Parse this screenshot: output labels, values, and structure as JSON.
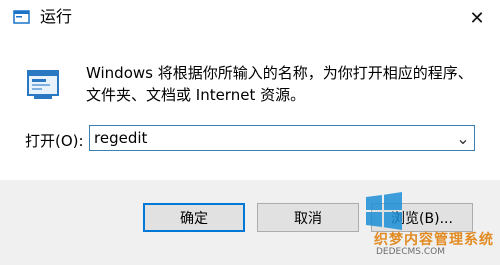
{
  "window": {
    "title": "运行",
    "close_glyph": "✕"
  },
  "content": {
    "description": "Windows 将根据你所输入的名称，为你打开相应的程序、文件夹、文档或 Internet 资源。",
    "open_label": "打开(O):",
    "input_value": "regedit",
    "dropdown_glyph": "⌄"
  },
  "buttons": {
    "ok": "确定",
    "cancel": "取消",
    "browse": "浏览(B)..."
  },
  "watermark": {
    "line1": "织梦内容管理系统",
    "line2": "DEDECMS.COM"
  }
}
